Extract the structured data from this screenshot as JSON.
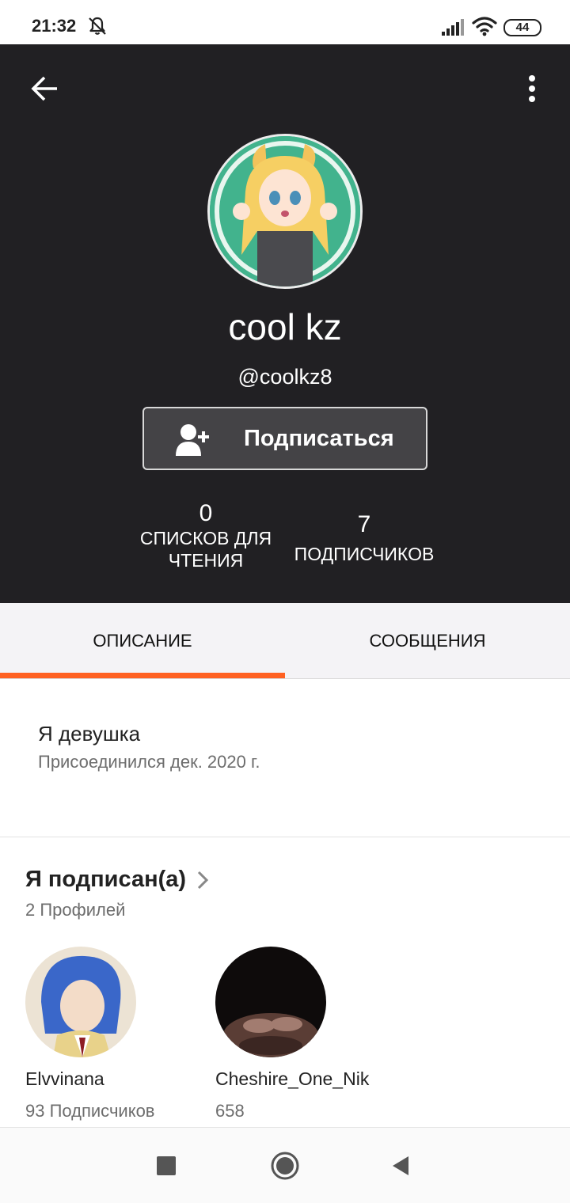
{
  "status_bar": {
    "time": "21:32",
    "battery": "44",
    "icons": [
      "bell-off-icon",
      "signal-icon",
      "wifi-icon",
      "battery-icon"
    ]
  },
  "header": {
    "back_icon": "arrow-left-icon",
    "menu_icon": "more-vert-icon",
    "name": "cool kz",
    "handle": "@coolkz8",
    "follow_button": {
      "label": "Подписаться",
      "icon": "add-user-icon"
    },
    "stats": {
      "reading_lists": {
        "value": "0",
        "label": "СПИСКОВ ДЛЯ ЧТЕНИЯ"
      },
      "followers": {
        "value": "7",
        "label": "ПОДПИСЧИКОВ"
      }
    },
    "background_color": "#212023"
  },
  "tabs": [
    {
      "label": "ОПИСАНИЕ",
      "active": true
    },
    {
      "label": "СООБЩЕНИЯ",
      "active": false
    }
  ],
  "accent_color": "#ff6122",
  "description": {
    "text": "Я девушка",
    "joined": "Присоединился дек. 2020 г."
  },
  "following": {
    "title": "Я подписан(а)",
    "count": "2 Профилей",
    "profiles": [
      {
        "name": "Elvvinana",
        "followers": "93 Подписчиков"
      },
      {
        "name": "Cheshire_One_Nik",
        "followers": "658"
      }
    ]
  },
  "nav_bar": {
    "icons": [
      "recents-square-icon",
      "home-circle-icon",
      "back-triangle-icon"
    ]
  }
}
